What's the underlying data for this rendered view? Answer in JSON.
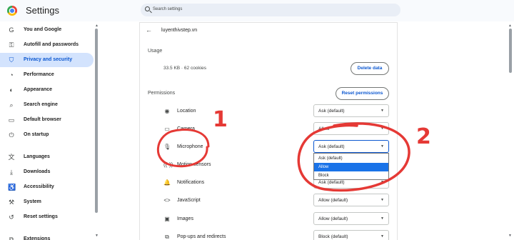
{
  "header": {
    "title": "Settings",
    "search_placeholder": "Search settings"
  },
  "sidebar": {
    "items": [
      {
        "label": "You and Google",
        "icon": "google-icon",
        "glyph": "G"
      },
      {
        "label": "Autofill and passwords",
        "icon": "key-icon",
        "glyph": "⚿"
      },
      {
        "label": "Privacy and security",
        "icon": "shield-icon",
        "glyph": "⛉",
        "active": true
      },
      {
        "label": "Performance",
        "icon": "speedometer-icon",
        "glyph": "◔"
      },
      {
        "label": "Appearance",
        "icon": "palette-icon",
        "glyph": "◐"
      },
      {
        "label": "Search engine",
        "icon": "search-icon",
        "glyph": "⌕"
      },
      {
        "label": "Default browser",
        "icon": "browser-icon",
        "glyph": "▭"
      },
      {
        "label": "On startup",
        "icon": "power-icon",
        "glyph": "⏻"
      },
      {
        "label": "Languages",
        "icon": "translate-icon",
        "glyph": "文"
      },
      {
        "label": "Downloads",
        "icon": "download-icon",
        "glyph": "⤓"
      },
      {
        "label": "Accessibility",
        "icon": "accessibility-icon",
        "glyph": "♿"
      },
      {
        "label": "System",
        "icon": "wrench-icon",
        "glyph": "⚒"
      },
      {
        "label": "Reset settings",
        "icon": "reset-icon",
        "glyph": "↺"
      },
      {
        "label": "Extensions",
        "icon": "puzzle-icon",
        "glyph": "⧉"
      }
    ]
  },
  "site": {
    "name": "luyenthivstep.vn",
    "usage_heading": "Usage",
    "usage_value": "33.5 KB · 62 cookies",
    "delete_label": "Delete data",
    "permissions_heading": "Permissions",
    "reset_label": "Reset permissions"
  },
  "permissions": [
    {
      "label": "Location",
      "value": "Ask (default)",
      "icon": "location-pin-icon",
      "glyph": "◉"
    },
    {
      "label": "Camera",
      "value": "Allow",
      "icon": "camera-icon",
      "glyph": "▭"
    },
    {
      "label": "Microphone",
      "value": "Ask (default)",
      "icon": "microphone-icon",
      "glyph": "🎙"
    },
    {
      "label": "Motion sensors",
      "value": "",
      "icon": "motion-sensor-icon",
      "glyph": "((·))"
    },
    {
      "label": "Notifications",
      "value": "Ask (default)",
      "icon": "bell-icon",
      "glyph": "🔔"
    },
    {
      "label": "JavaScript",
      "value": "Allow (default)",
      "icon": "code-icon",
      "glyph": "<>"
    },
    {
      "label": "Images",
      "value": "Allow (default)",
      "icon": "image-icon",
      "glyph": "▣"
    },
    {
      "label": "Pop-ups and redirects",
      "value": "Block (default)",
      "icon": "popup-icon",
      "glyph": "⧉"
    }
  ],
  "dropdown": {
    "options": [
      "Ask (default)",
      "Allow",
      "Block"
    ],
    "highlighted": "Allow"
  },
  "annotations": {
    "label_1": "1",
    "label_2": "2",
    "color": "#e53935"
  }
}
